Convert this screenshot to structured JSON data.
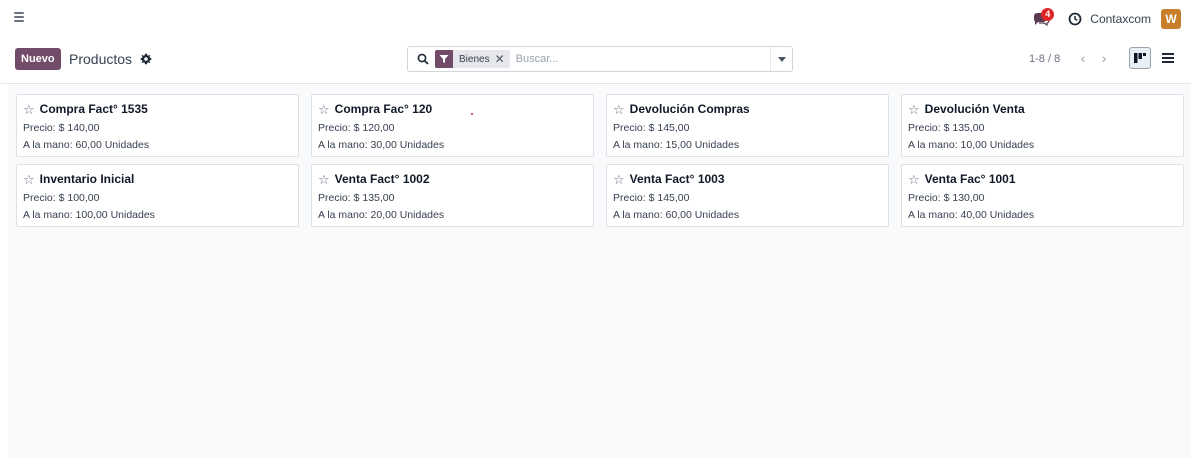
{
  "topbar": {
    "menu_icon": "hamburger-icon",
    "chat_icon": "chat-bubbles-icon",
    "chat_badge": "4",
    "activity_icon": "clock-icon",
    "company": "Contaxcom",
    "avatar_letter": "W",
    "avatar_color": "#c97f2a"
  },
  "control_panel": {
    "new_button": "Nuevo",
    "breadcrumb": "Productos",
    "settings_icon": "gear-icon",
    "search": {
      "facet_icon": "filter-icon",
      "facet_label": "Bienes",
      "placeholder": "Buscar..."
    },
    "pager": "1-8 / 8",
    "views": [
      "kanban",
      "list"
    ],
    "active_view": "kanban"
  },
  "colors": {
    "primary": "#714b67",
    "badge": "#dc2626"
  },
  "products": [
    {
      "name": "Compra Fact° 1535",
      "price": "Precio: $ 140,00",
      "qty": "A la mano: 60,00 Unidades"
    },
    {
      "name": "Compra Fac° 120",
      "price": "Precio: $ 120,00",
      "qty": "A la mano: 30,00 Unidades"
    },
    {
      "name": "Devolución Compras",
      "price": "Precio: $ 145,00",
      "qty": "A la mano: 15,00 Unidades"
    },
    {
      "name": "Devolución Venta",
      "price": "Precio: $ 135,00",
      "qty": "A la mano: 10,00 Unidades"
    },
    {
      "name": "Inventario Inicial",
      "price": "Precio: $ 100,00",
      "qty": "A la mano: 100,00 Unidades"
    },
    {
      "name": "Venta Fact° 1002",
      "price": "Precio: $ 135,00",
      "qty": "A la mano: 20,00 Unidades"
    },
    {
      "name": "Venta Fact° 1003",
      "price": "Precio: $ 145,00",
      "qty": "A la mano: 60,00 Unidades"
    },
    {
      "name": "Venta Fac° 1001",
      "price": "Precio: $ 130,00",
      "qty": "A la mano: 40,00 Unidades"
    }
  ]
}
